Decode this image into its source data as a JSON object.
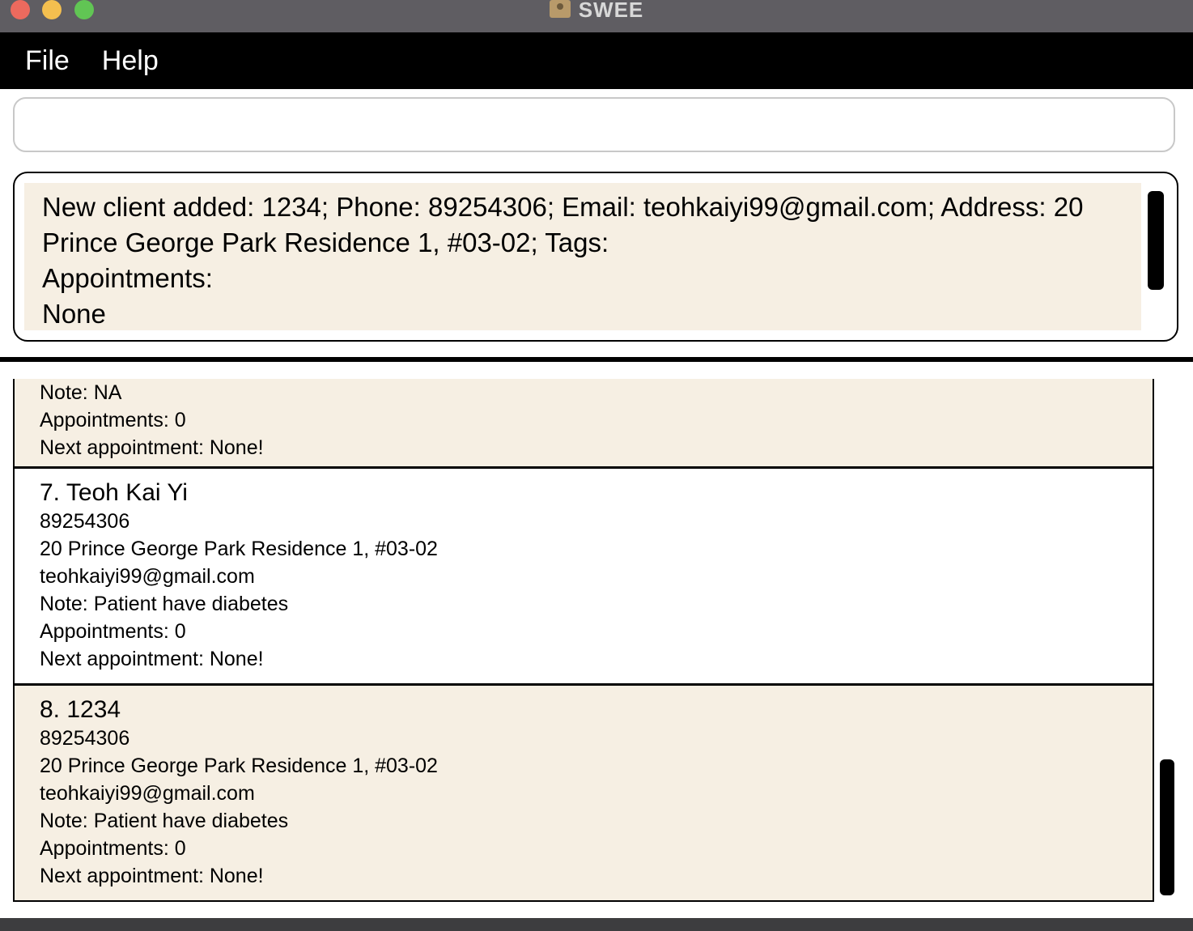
{
  "window": {
    "title": "SWEE"
  },
  "menu": {
    "file": "File",
    "help": "Help"
  },
  "command": {
    "value": "",
    "placeholder": ""
  },
  "result": {
    "text": "New client added: 1234; Phone: 89254306; Email: teohkaiyi99@gmail.com; Address: 20 Prince George Park Residence 1, #03-02; Tags: \nAppointments: \nNone"
  },
  "clients": {
    "partial": {
      "note": "Note: NA",
      "appointments": "Appointments: 0",
      "next": "Next appointment: None!"
    },
    "c7": {
      "title": "7.  Teoh Kai Yi",
      "phone": "89254306",
      "address": "20 Prince George Park Residence 1, #03-02",
      "email": "teohkaiyi99@gmail.com",
      "note": "Note: Patient have diabetes",
      "appointments": "Appointments: 0",
      "next": "Next appointment: None!"
    },
    "c8": {
      "title": "8.  1234",
      "phone": "89254306",
      "address": "20 Prince George Park Residence 1, #03-02",
      "email": "teohkaiyi99@gmail.com",
      "note": "Note: Patient have diabetes",
      "appointments": "Appointments: 0",
      "next": "Next appointment: None!"
    }
  },
  "colors": {
    "card_beige": "#f6efe3",
    "menubar": "#000000",
    "titlebar": "#5f5d62"
  }
}
